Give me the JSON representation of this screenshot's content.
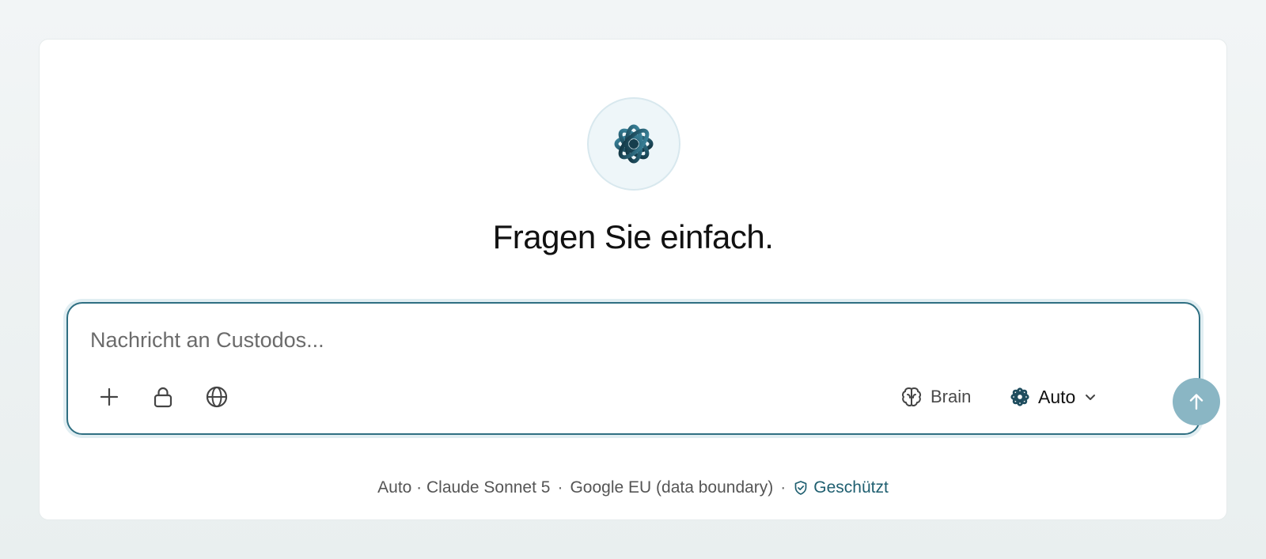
{
  "hero": {
    "title": "Fragen Sie einfach."
  },
  "composer": {
    "placeholder": "Nachricht an Custodos...",
    "value": "",
    "tools": [
      {
        "icon": "plus-icon"
      },
      {
        "icon": "lock-icon"
      },
      {
        "icon": "globe-icon"
      }
    ],
    "brain_label": "Brain",
    "model_label": "Auto"
  },
  "status": {
    "model": "Auto · Claude Sonnet 5",
    "separator": "·",
    "region": "Google EU (data boundary)",
    "protected_label": "Geschützt"
  },
  "colors": {
    "accent": "#2f6f82",
    "send_button": "#8ab6c4",
    "protected_text": "#1f5f70"
  }
}
